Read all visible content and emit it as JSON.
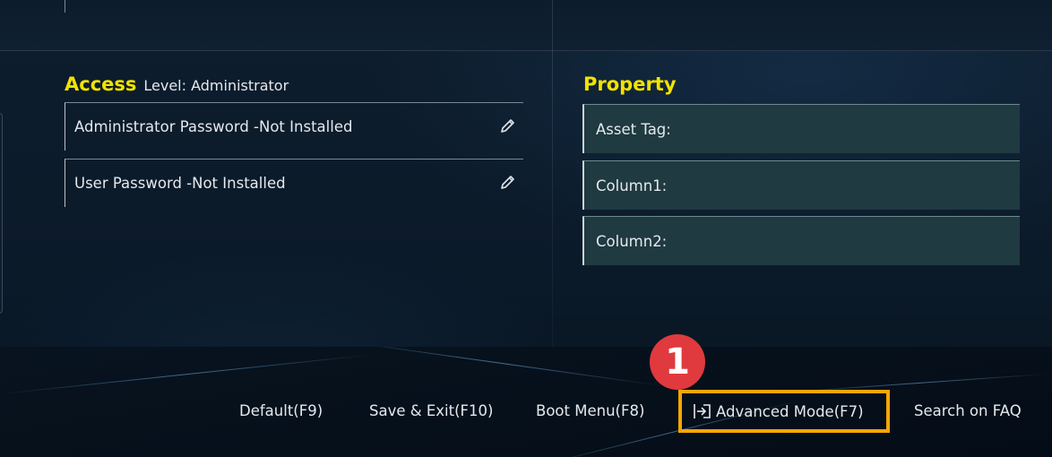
{
  "access": {
    "title": "Access",
    "level_label": "Level: Administrator",
    "rows": [
      {
        "label": "Administrator Password -Not Installed",
        "icon": "pencil-icon"
      },
      {
        "label": "User Password -Not Installed",
        "icon": "pencil-icon"
      }
    ]
  },
  "property": {
    "title": "Property",
    "rows": [
      {
        "label": "Asset Tag:"
      },
      {
        "label": "Column1:"
      },
      {
        "label": "Column2:"
      }
    ]
  },
  "footer": {
    "default_label": "Default(F9)",
    "save_exit_label": "Save & Exit(F10)",
    "boot_menu_label": "Boot Menu(F8)",
    "advanced_mode_label": "Advanced Mode(F7)",
    "advanced_mode_icon": "exit-arrow-icon",
    "faq_label": "Search on FAQ"
  },
  "annotation": {
    "step_number": "1",
    "badge_color": "#e03a3e",
    "highlight_color": "#f6a700"
  },
  "colors": {
    "section_title": "#f2e200",
    "property_field_bg": "#1f3a40"
  }
}
